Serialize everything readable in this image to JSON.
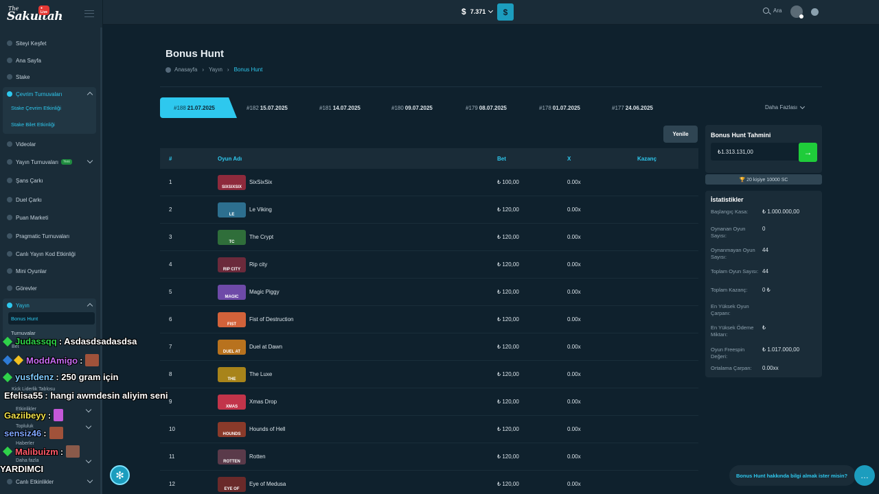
{
  "logo": {
    "the": "The",
    "name": "Sakultah",
    "live": "● Live"
  },
  "sidebar": {
    "items": [
      {
        "label": "Siteyi Keşfet"
      },
      {
        "label": "Ana Sayfa"
      },
      {
        "label": "Stake"
      },
      {
        "label": "Çevrim Turnuvaları"
      },
      {
        "label": "Stake Çevrim Etkinliği"
      },
      {
        "label": "Stake Bilet Etkinliği"
      },
      {
        "label": "Videolar"
      },
      {
        "label": "Yayın Turnuvaları",
        "badge": "Yeni"
      },
      {
        "label": "Şans Çarkı"
      },
      {
        "label": "Duel Çarkı"
      },
      {
        "label": "Puan Marketi"
      },
      {
        "label": "Pragmatic Turnuvaları"
      },
      {
        "label": "Canlı Yayın Kod Etkinliği"
      },
      {
        "label": "Mini Oyunlar"
      },
      {
        "label": "Görevler"
      },
      {
        "label": "Yayın"
      },
      {
        "label": "Bonus Hunt"
      },
      {
        "label": "Turnuvalar"
      },
      {
        "label": "Bet"
      },
      {
        "label": "Kick Liderlik Tablosu"
      },
      {
        "label": "Etkinlikler"
      },
      {
        "label": "Topluluk"
      },
      {
        "label": "Haberler"
      },
      {
        "label": "Daha fazla"
      },
      {
        "label": "Canlı Etkinlikler"
      }
    ]
  },
  "topbar": {
    "currency": "$",
    "balance": "7.371",
    "wallet_icon": "$",
    "search": "Ara"
  },
  "page": {
    "title": "Bonus Hunt",
    "breadcrumb": [
      "Anasayfa",
      "Yayın",
      "Bonus Hunt"
    ]
  },
  "tabs": [
    {
      "num": "#188",
      "date": "21.07.2025"
    },
    {
      "num": "#182",
      "date": "15.07.2025"
    },
    {
      "num": "#181",
      "date": "14.07.2025"
    },
    {
      "num": "#180",
      "date": "09.07.2025"
    },
    {
      "num": "#179",
      "date": "08.07.2025"
    },
    {
      "num": "#178",
      "date": "01.07.2025"
    },
    {
      "num": "#177",
      "date": "24.06.2025"
    }
  ],
  "more_label": "Daha Fazlası",
  "refresh_label": "Yenile",
  "table": {
    "headers": [
      "#",
      "Oyun Adı",
      "Bet",
      "X",
      "Kazanç"
    ],
    "rows": [
      {
        "n": "1",
        "game": "SixSixSix",
        "thumb": "SIXSIXSIX",
        "bet": "₺ 100,00",
        "x": "0.00x",
        "color": "#8e2a3c"
      },
      {
        "n": "2",
        "game": "Le Viking",
        "thumb": "LE",
        "bet": "₺ 120,00",
        "x": "0.00x",
        "color": "#2d6f8f"
      },
      {
        "n": "3",
        "game": "The Crypt",
        "thumb": "TC",
        "bet": "₺ 120,00",
        "x": "0.00x",
        "color": "#2f6e3a"
      },
      {
        "n": "4",
        "game": "Rip city",
        "thumb": "RIP CITY",
        "bet": "₺ 120,00",
        "x": "0.00x",
        "color": "#6b2a3b"
      },
      {
        "n": "5",
        "game": "Magic Piggy",
        "thumb": "MAGIC",
        "bet": "₺ 120,00",
        "x": "0.00x",
        "color": "#6e4aa8"
      },
      {
        "n": "6",
        "game": "Fist of Destruction",
        "thumb": "FIST",
        "bet": "₺ 120,00",
        "x": "0.00x",
        "color": "#d2623a"
      },
      {
        "n": "7",
        "game": "Duel at Dawn",
        "thumb": "DUEL AT",
        "bet": "₺ 120,00",
        "x": "0.00x",
        "color": "#b8721e"
      },
      {
        "n": "8",
        "game": "The Luxe",
        "thumb": "THE",
        "bet": "₺ 120,00",
        "x": "0.00x",
        "color": "#a8841a"
      },
      {
        "n": "9",
        "game": "Xmas Drop",
        "thumb": "XMAS",
        "bet": "₺ 120,00",
        "x": "0.00x",
        "color": "#c2344a"
      },
      {
        "n": "10",
        "game": "Hounds of Hell",
        "thumb": "HOUNDS",
        "bet": "₺ 120,00",
        "x": "0.00x",
        "color": "#8a3a2a"
      },
      {
        "n": "11",
        "game": "Rotten",
        "thumb": "ROTTEN",
        "bet": "₺ 120,00",
        "x": "0.00x",
        "color": "#5a3a4a"
      },
      {
        "n": "12",
        "game": "Eye of Medusa",
        "thumb": "EYE OF",
        "bet": "₺ 120,00",
        "x": "0.00x",
        "color": "#6a2a2a"
      }
    ]
  },
  "prediction": {
    "title": "Bonus Hunt Tahmini",
    "value": "₺1.313.131,00",
    "prize": "🏆 20 kişiye 10000 SC"
  },
  "stats": {
    "title": "İstatistikler",
    "items": [
      {
        "label": "Başlangıç Kasa:",
        "value": "₺ 1.000.000,00"
      },
      {
        "label": "Oynanan Oyun Sayısı:",
        "value": "0"
      },
      {
        "label": "Oynanmayan Oyun Sayısı:",
        "value": "44"
      },
      {
        "label": "Toplam Oyun Sayısı:",
        "value": "44"
      },
      {
        "label": "Toplam Kazanç:",
        "value": "0 ₺"
      },
      {
        "label": "En Yüksek Oyun Çarpanı:",
        "value": ""
      },
      {
        "label": "En Yüksek Ödeme Miktarı:",
        "value": "₺"
      },
      {
        "label": "Oyun Freespin Değeri:",
        "value": "₺ 1.017.000,00"
      },
      {
        "label": "Ortalama Çarpan:",
        "value": "0.00xx"
      }
    ]
  },
  "chat": [
    {
      "user": "Judassqq",
      "text": ": Asdasdsadasdsa",
      "color": "#2fd24a"
    },
    {
      "user": "ModdAmigo",
      "text": ":",
      "color": "#c56cf0"
    },
    {
      "user": "yusfdenz",
      "text": ": 250 gram için",
      "color": "#7ecbff"
    },
    {
      "user": "Efelisa55",
      "text": ": hangi awmdesin aliyim seni",
      "color": "#ffffff"
    },
    {
      "user": "Gaziibeyy",
      "text": ":",
      "color": "#f0e14a"
    },
    {
      "user": "sensiz46",
      "text": ":",
      "color": "#7ea6ff"
    },
    {
      "user": "Malibuizm",
      "text": ":",
      "color": "#ff5a6a"
    },
    {
      "user": "",
      "text": "YARDIMCI",
      "color": "#ffffff"
    }
  ],
  "help": {
    "bubble": "Bonus Hunt hakkında bilgi almak ister misin?"
  }
}
